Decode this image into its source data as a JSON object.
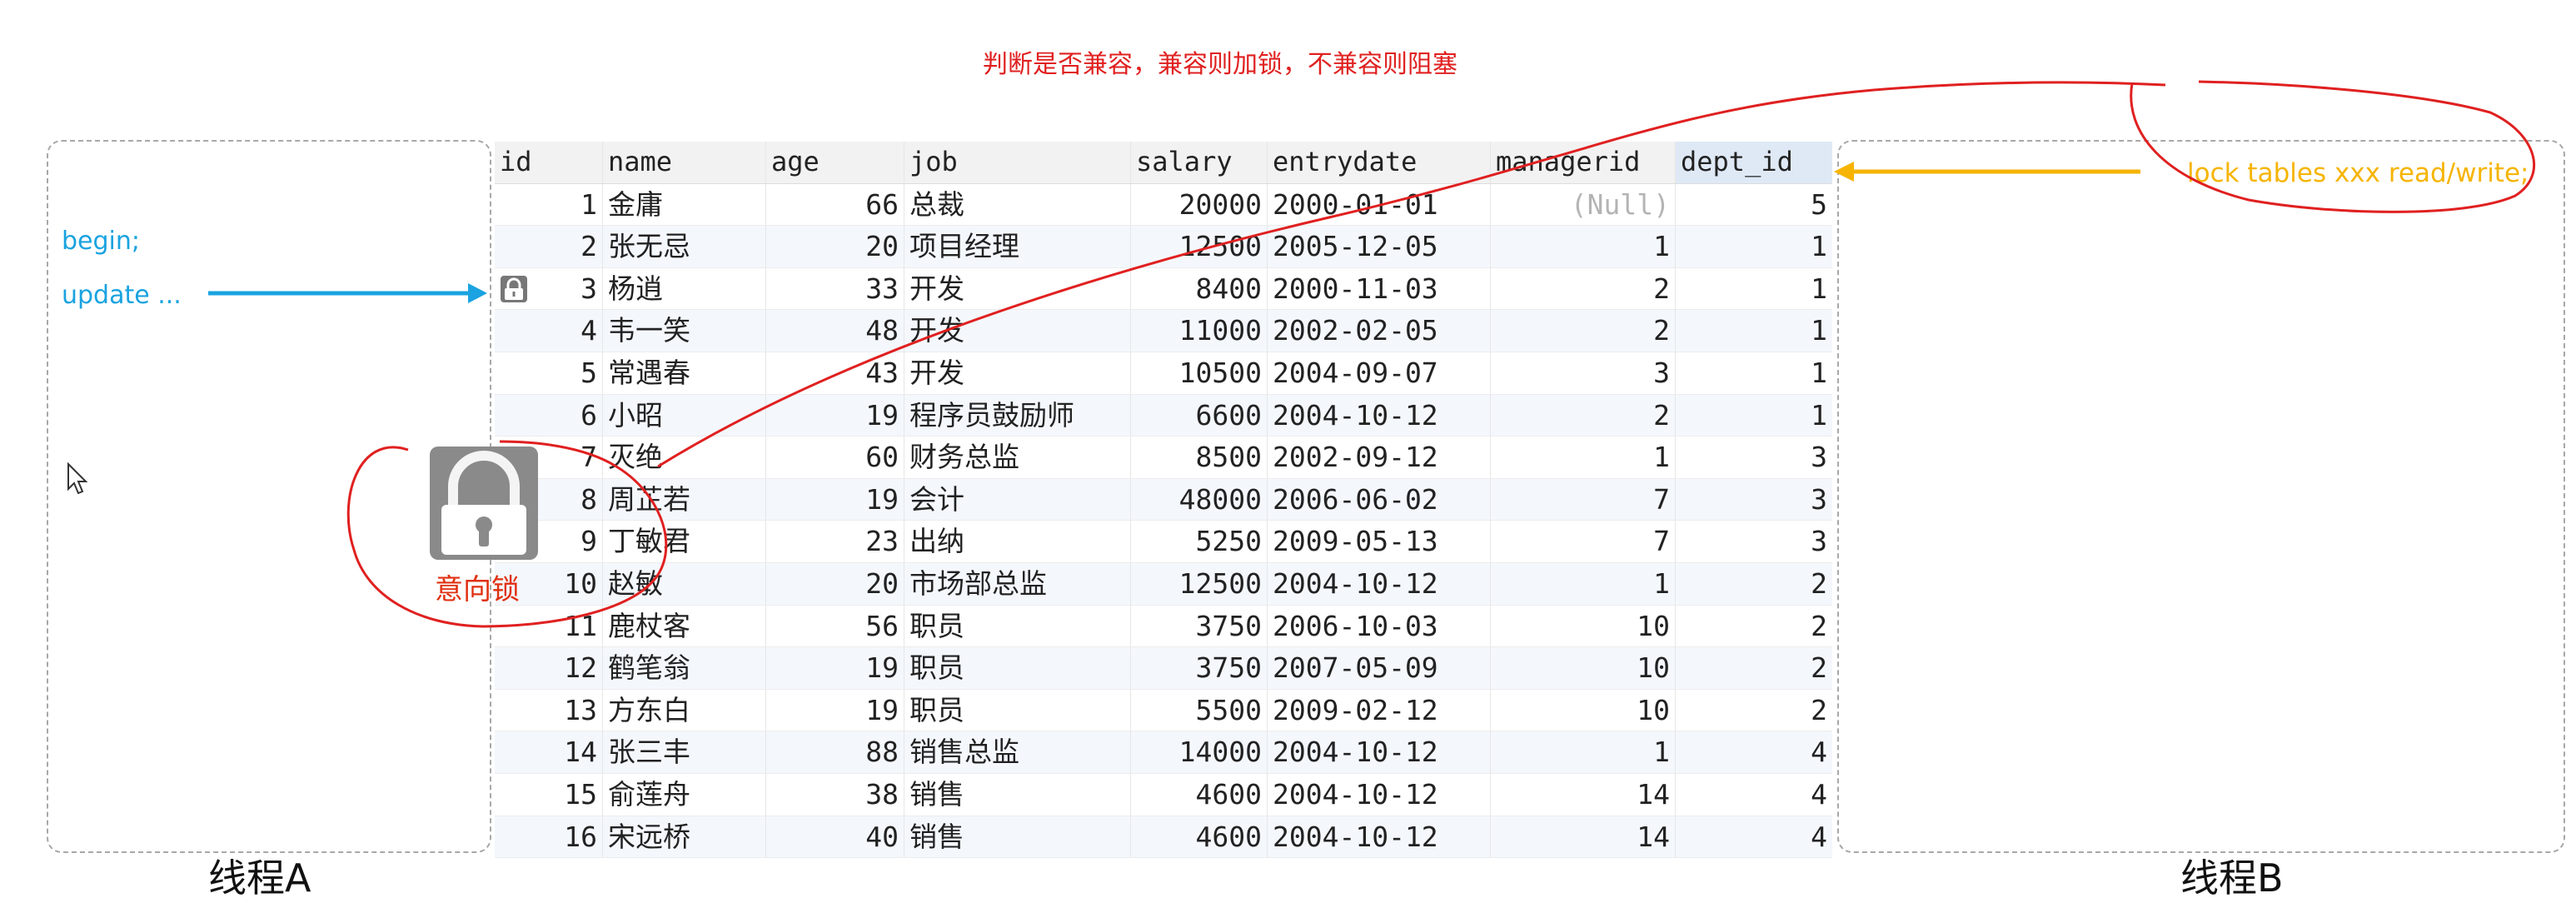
{
  "top_note": "判断是否兼容，兼容则加锁，不兼容则阻塞",
  "thread_a": {
    "label": "线程A",
    "code": [
      "begin;",
      "update ..."
    ]
  },
  "thread_b": {
    "label": "线程B",
    "command": "lock tables xxx read/write;"
  },
  "intent_lock": {
    "label": "意向锁"
  },
  "colors": {
    "red": "#e02020",
    "blue": "#1aa3e0",
    "orange": "#f6b400",
    "lock_gray": "#8a8a8a"
  },
  "table": {
    "columns": [
      "id",
      "name",
      "age",
      "job",
      "salary",
      "entrydate",
      "managerid",
      "dept_id"
    ],
    "locked_row_index": 2,
    "rows": [
      [
        "1",
        "金庸",
        "66",
        "总裁",
        "20000",
        "2000-01-01",
        "(Null)",
        "5"
      ],
      [
        "2",
        "张无忌",
        "20",
        "项目经理",
        "12500",
        "2005-12-05",
        "1",
        "1"
      ],
      [
        "3",
        "杨逍",
        "33",
        "开发",
        "8400",
        "2000-11-03",
        "2",
        "1"
      ],
      [
        "4",
        "韦一笑",
        "48",
        "开发",
        "11000",
        "2002-02-05",
        "2",
        "1"
      ],
      [
        "5",
        "常遇春",
        "43",
        "开发",
        "10500",
        "2004-09-07",
        "3",
        "1"
      ],
      [
        "6",
        "小昭",
        "19",
        "程序员鼓励师",
        "6600",
        "2004-10-12",
        "2",
        "1"
      ],
      [
        "7",
        "灭绝",
        "60",
        "财务总监",
        "8500",
        "2002-09-12",
        "1",
        "3"
      ],
      [
        "8",
        "周芷若",
        "19",
        "会计",
        "48000",
        "2006-06-02",
        "7",
        "3"
      ],
      [
        "9",
        "丁敏君",
        "23",
        "出纳",
        "5250",
        "2009-05-13",
        "7",
        "3"
      ],
      [
        "10",
        "赵敏",
        "20",
        "市场部总监",
        "12500",
        "2004-10-12",
        "1",
        "2"
      ],
      [
        "11",
        "鹿杖客",
        "56",
        "职员",
        "3750",
        "2006-10-03",
        "10",
        "2"
      ],
      [
        "12",
        "鹤笔翁",
        "19",
        "职员",
        "3750",
        "2007-05-09",
        "10",
        "2"
      ],
      [
        "13",
        "方东白",
        "19",
        "职员",
        "5500",
        "2009-02-12",
        "10",
        "2"
      ],
      [
        "14",
        "张三丰",
        "88",
        "销售总监",
        "14000",
        "2004-10-12",
        "1",
        "4"
      ],
      [
        "15",
        "俞莲舟",
        "38",
        "销售",
        "4600",
        "2004-10-12",
        "14",
        "4"
      ],
      [
        "16",
        "宋远桥",
        "40",
        "销售",
        "4600",
        "2004-10-12",
        "14",
        "4"
      ]
    ]
  }
}
